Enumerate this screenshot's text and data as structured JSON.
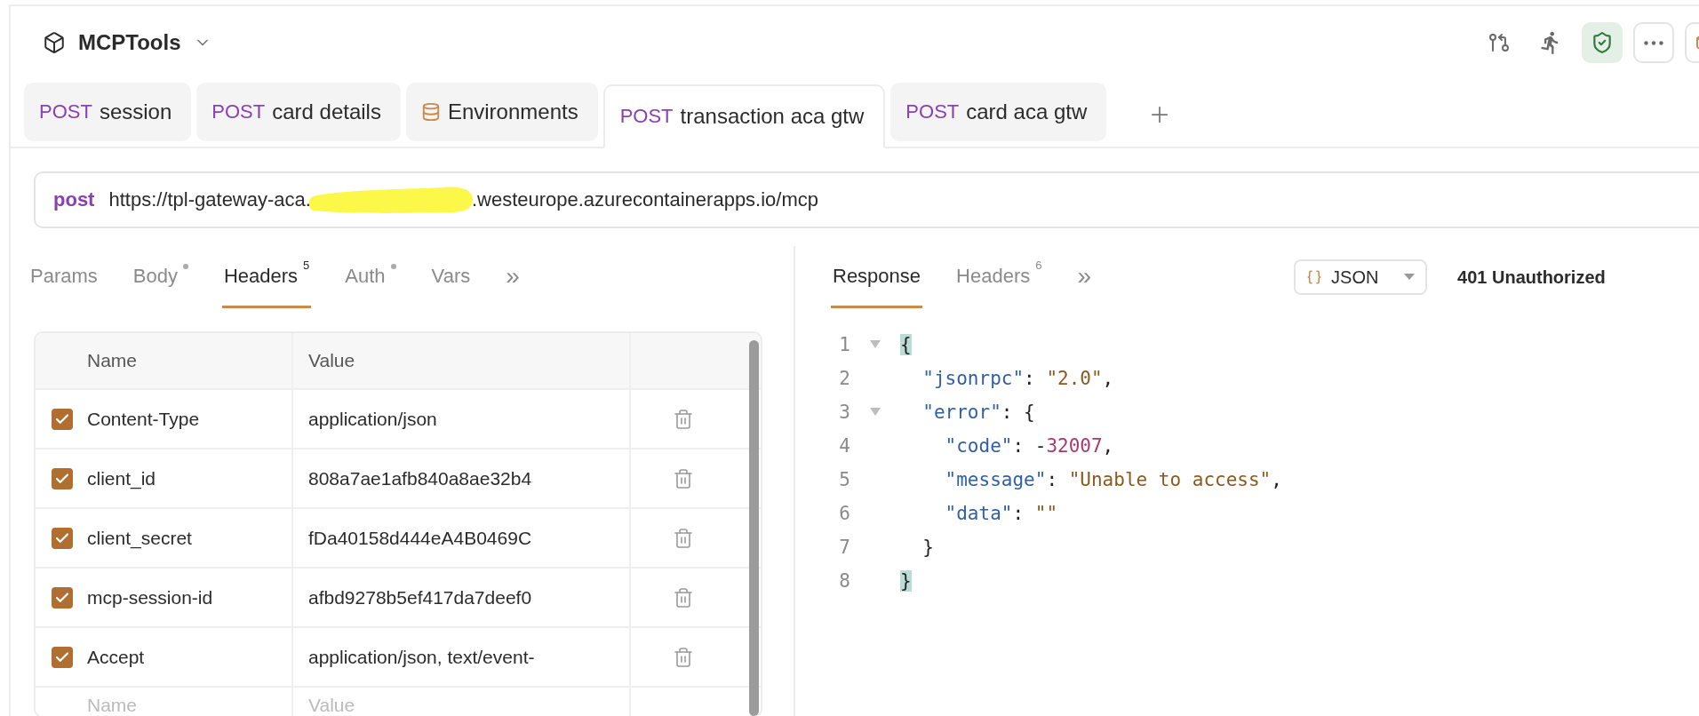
{
  "workspace": {
    "title": "MCPTools"
  },
  "toolbar": [
    {
      "kind": "branch",
      "on": false
    },
    {
      "kind": "runner",
      "on": false
    },
    {
      "kind": "shield",
      "on": true
    },
    {
      "kind": "more",
      "on": false
    },
    {
      "kind": "package",
      "on": false
    }
  ],
  "tabs": [
    {
      "kind": "request",
      "method": "POST",
      "label": "session",
      "selected": false
    },
    {
      "kind": "request",
      "method": "POST",
      "label": "card details",
      "selected": false
    },
    {
      "kind": "environment",
      "label": "Environments",
      "selected": false
    },
    {
      "kind": "request",
      "method": "POST",
      "label": "transaction aca gtw",
      "selected": true
    },
    {
      "kind": "request",
      "method": "POST",
      "label": "card aca gtw",
      "selected": false
    }
  ],
  "url_bar": {
    "method": "post",
    "url_start": "https://tpl-gateway-aca.",
    "redacted": true,
    "url_end": ".westeurope.azurecontainerapps.io/mcp"
  },
  "request_tabs": [
    {
      "label": "Params",
      "selected": false
    },
    {
      "label": "Body",
      "dot": true,
      "selected": false
    },
    {
      "label": "Headers",
      "count": "5",
      "selected": true
    },
    {
      "label": "Auth",
      "dot": true,
      "selected": false
    },
    {
      "label": "Vars",
      "selected": false
    },
    {
      "kind": "more",
      "label": "»",
      "selected": false
    }
  ],
  "headers_table": {
    "columns": [
      "Name",
      "Value"
    ],
    "rows": [
      {
        "checked": true,
        "name": "Content-Type",
        "value": "application/json"
      },
      {
        "checked": true,
        "name": "client_id",
        "value": "808a7ae1afb840a8ae32b4"
      },
      {
        "checked": true,
        "name": "client_secret",
        "value": "fDa40158d444eA4B0469C"
      },
      {
        "checked": true,
        "name": "mcp-session-id",
        "value": "afbd9278b5ef417da7deef0"
      },
      {
        "checked": true,
        "name": "Accept",
        "value": "application/json, text/event-"
      }
    ],
    "new_row": {
      "name_placeholder": "Name",
      "value_placeholder": "Value"
    }
  },
  "response_tabs": [
    {
      "label": "Response",
      "selected": true
    },
    {
      "label": "Headers",
      "count": "6",
      "selected": false
    },
    {
      "kind": "more",
      "label": "»",
      "selected": false
    }
  ],
  "format_select": {
    "value": "JSON"
  },
  "status": "401 Unauthorized",
  "code_lines": [
    {
      "number": "1",
      "fold": true,
      "tokens": [
        {
          "kind": "brace_match",
          "text": "{"
        }
      ]
    },
    {
      "number": "2",
      "fold": false,
      "tokens": [
        {
          "kind": "key",
          "text": "  \"jsonrpc\""
        },
        {
          "kind": "punct",
          "text": ": "
        },
        {
          "kind": "string",
          "text": "\"2.0\""
        },
        {
          "kind": "punct",
          "text": ","
        }
      ]
    },
    {
      "number": "3",
      "fold": true,
      "tokens": [
        {
          "kind": "key",
          "text": "  \"error\""
        },
        {
          "kind": "punct",
          "text": ": {"
        }
      ]
    },
    {
      "number": "4",
      "fold": false,
      "tokens": [
        {
          "kind": "key",
          "text": "    \"code\""
        },
        {
          "kind": "punct",
          "text": ": -"
        },
        {
          "kind": "number",
          "text": "32007"
        },
        {
          "kind": "punct",
          "text": ","
        }
      ]
    },
    {
      "number": "5",
      "fold": false,
      "tokens": [
        {
          "kind": "key",
          "text": "    \"message\""
        },
        {
          "kind": "punct",
          "text": ": "
        },
        {
          "kind": "string",
          "text": "\"Unable to access\""
        },
        {
          "kind": "punct",
          "text": ","
        }
      ]
    },
    {
      "number": "6",
      "fold": false,
      "tokens": [
        {
          "kind": "key",
          "text": "    \"data\""
        },
        {
          "kind": "punct",
          "text": ": "
        },
        {
          "kind": "string",
          "text": "\"\""
        }
      ]
    },
    {
      "number": "7",
      "fold": false,
      "tokens": [
        {
          "kind": "punct",
          "text": "  }"
        }
      ]
    },
    {
      "number": "8",
      "fold": false,
      "tokens": [
        {
          "kind": "brace_match",
          "text": "}"
        }
      ]
    }
  ]
}
